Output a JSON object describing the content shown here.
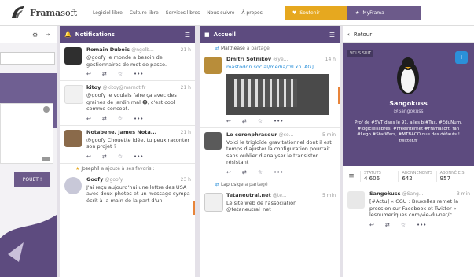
{
  "brand": {
    "name_prefix": "Frama",
    "name_suffix": "soft"
  },
  "nav": [
    "Logiciel libre",
    "Culture libre",
    "Services libres",
    "Nous suivre",
    "À propos"
  ],
  "buttons": {
    "soutenir": "Soutenir",
    "myframa": "MyFrama"
  },
  "left_panel": {
    "button": "POUET !"
  },
  "notifications": {
    "title": "Notifications",
    "items": [
      {
        "user": "Romain Dubois",
        "acct": "@ngelb...",
        "time": "21 h",
        "text": "@goofy le monde a besoin de gestionnaires de mot de passe."
      },
      {
        "user": "kitoy",
        "acct": "@kitoy@mamot.fr",
        "time": "21 h",
        "text": "@goofy je voulais faire ça avec des graines de jardin mal ☻, c'est cool comme concept."
      },
      {
        "user": "Notabene. James Nota...",
        "acct": "",
        "time": "21 h",
        "text": "@goofy Chouette idée, tu peux raconter son projet ?"
      }
    ],
    "boost": {
      "who": "Josephll",
      "action": "a ajouté à ses favoris :"
    },
    "last": {
      "user": "Goofy",
      "acct": "@goofy",
      "time": "23 h",
      "text": "J'ai reçu aujourd'hui une lettre des USA avec deux photos et un message sympa écrit à la main de la part d'un"
    }
  },
  "home": {
    "title": "Accueil",
    "top_boost": {
      "who": "Malthease",
      "action": "a partagé"
    },
    "items": [
      {
        "user": "Dmitri Sotnikov",
        "acct": "@ye...",
        "time": "14 h",
        "text": "mastodon.social/media/fYLxnTAG]...",
        "has_image": true
      },
      {
        "user": "Le coronphraseur",
        "acct": "@co...",
        "time": "5 min",
        "text": "Voici le trigloïde gravitationnel dont il est temps d'ajuster la configuration pourrait sans oublier d'analyser le transistor résistant"
      }
    ],
    "boost2": {
      "who": "Laplusige",
      "action": "a partagé"
    },
    "last": {
      "user": "Tetaneutral.net",
      "acct": "@te...",
      "time": "5 min",
      "text": "Le site web de l'association @tetaneutral_net"
    }
  },
  "profile": {
    "back": "Retour",
    "badge": "VOUS SUIT",
    "name": "Sangokuss",
    "handle": "@Sangokuss",
    "bio": "Prof de #SVT dans le 91, ailes bi#Tux, #EduNum, #logicielslibres, #FreeInternet #Framasoft, fan #Lego #StarWars, #MTBACO que des défauts ! twitter.fr",
    "stats": [
      {
        "label": "STATUTS",
        "value": "4 606"
      },
      {
        "label": "ABONNEMENTS",
        "value": "642"
      },
      {
        "label": "ABONNÉ·E·S",
        "value": "957"
      }
    ],
    "post": {
      "user": "Sangokuss",
      "acct": "@Sang...",
      "time": "3 min",
      "text": "[#Actu] « CGU : Bruxelles remet la pression sur Facebook et Twitter » lesnumeriques.com/vie-du-net/c..."
    }
  },
  "colors": {
    "accent": "#5d4b7f",
    "soutenir": "#e6a81f",
    "myframa": "#6c5a8a",
    "link": "#2b90d9"
  }
}
